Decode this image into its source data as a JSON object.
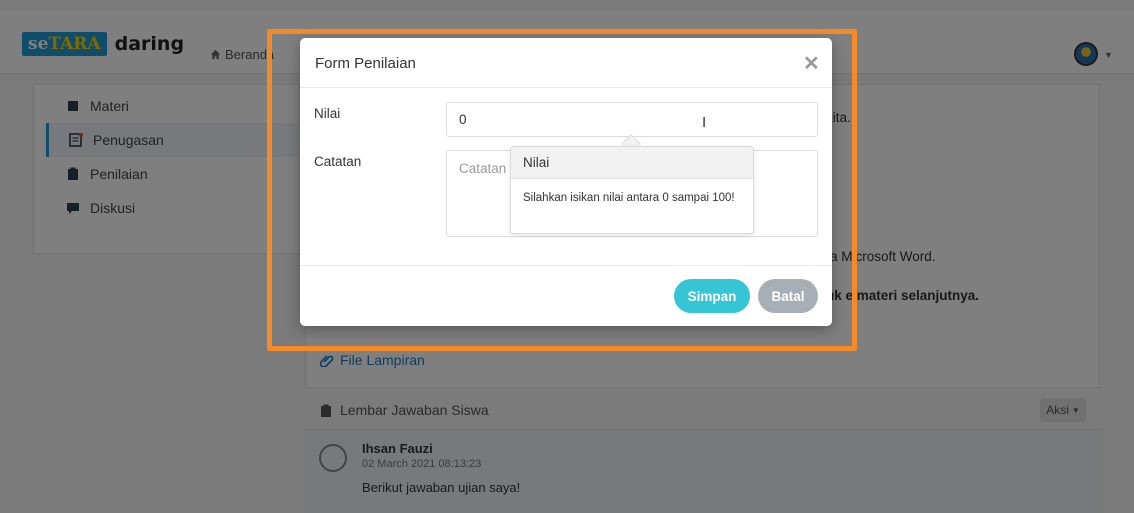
{
  "header": {
    "logo_part1": "se",
    "logo_part2": "TARA",
    "logo_word": "daring",
    "home_label": "Beranda"
  },
  "sidebar": {
    "items": [
      {
        "label": "Materi",
        "icon": "book-icon"
      },
      {
        "label": "Penugasan",
        "icon": "assignment-icon"
      },
      {
        "label": "Penilaian",
        "icon": "clipboard-icon"
      },
      {
        "label": "Diskusi",
        "icon": "chat-icon"
      }
    ],
    "active_index": 1
  },
  "main": {
    "text_snippet_1": "kita.",
    "text_snippet_2": "a Microsoft Word.",
    "text_snippet_3": "uk  e materi selanjutnya.",
    "attachment_label": "File Lampiran",
    "answers_title": "Lembar Jawaban Siswa",
    "aksi_label": "Aksi",
    "answer": {
      "name": "Ihsan Fauzi",
      "date": "02 March 2021 08:13:23",
      "text": "Berikut jawaban ujian saya!"
    }
  },
  "modal": {
    "title": "Form Penilaian",
    "close_glyph": "✕",
    "nilai_label": "Nilai",
    "nilai_value": "0",
    "catatan_label": "Catatan",
    "catatan_placeholder": "Catatan",
    "save_label": "Simpan",
    "cancel_label": "Batal"
  },
  "popover": {
    "title": "Nilai",
    "body": "Silahkan isikan nilai antara 0 sampai 100!"
  },
  "colors": {
    "highlight": "#f58a2a",
    "primary": "#36c5d5",
    "secondary": "#a8aeb6",
    "brand": "#1f9ad6"
  }
}
